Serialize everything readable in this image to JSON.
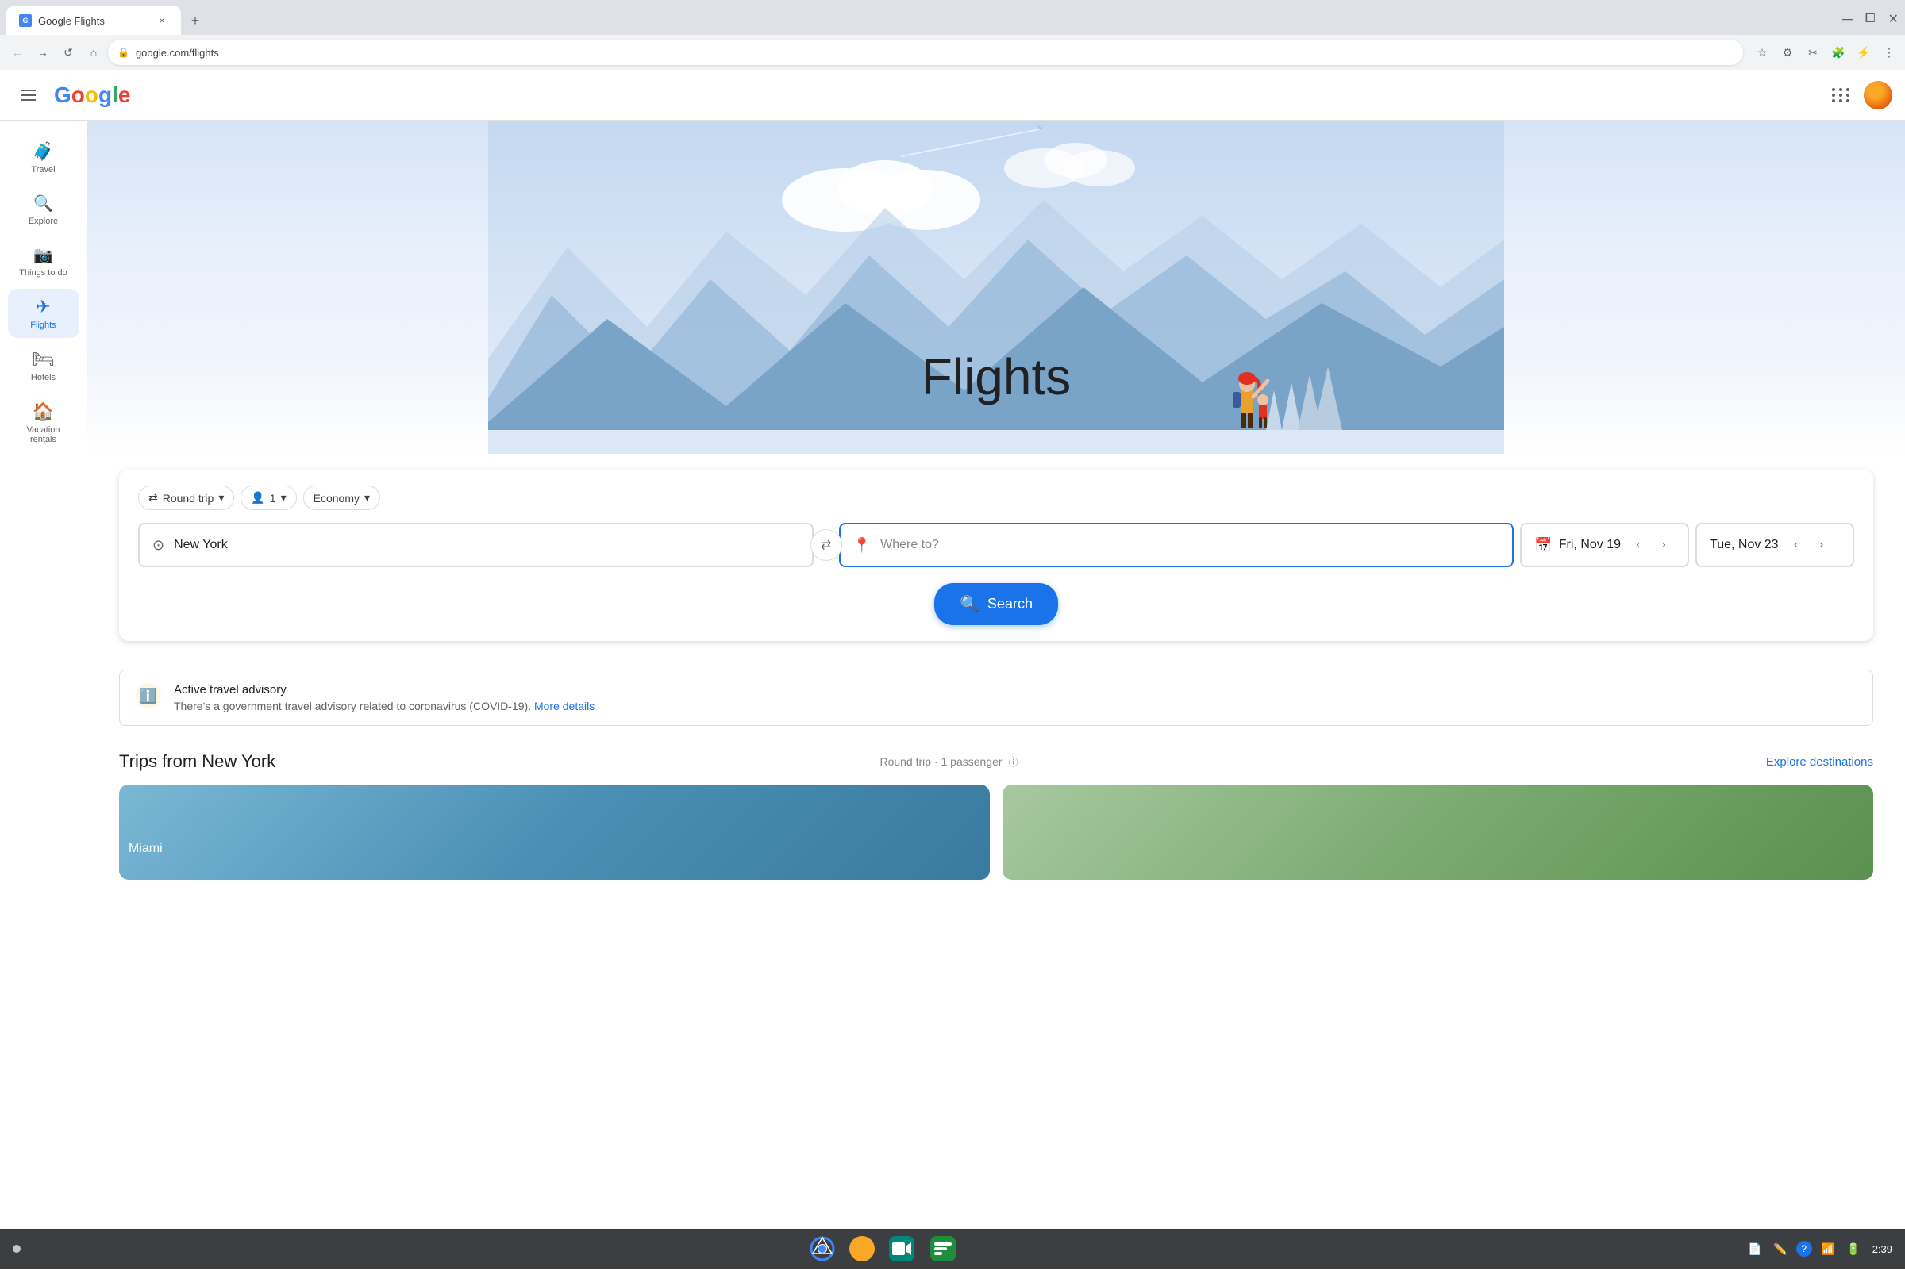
{
  "browser": {
    "tab_title": "Google Flights",
    "url": "google.com/flights",
    "favicon": "G"
  },
  "app_bar": {
    "logo_parts": [
      "G",
      "o",
      "o",
      "g",
      "l",
      "e"
    ],
    "menu_icon": "☰"
  },
  "sidebar": {
    "items": [
      {
        "id": "travel",
        "label": "Travel",
        "icon": "🧳",
        "active": false
      },
      {
        "id": "explore",
        "label": "Explore",
        "icon": "🔍",
        "active": false
      },
      {
        "id": "things-to-do",
        "label": "Things to do",
        "icon": "📷",
        "active": false
      },
      {
        "id": "flights",
        "label": "Flights",
        "icon": "✈️",
        "active": true
      },
      {
        "id": "hotels",
        "label": "Hotels",
        "icon": "🛏️",
        "active": false
      },
      {
        "id": "vacation-rentals",
        "label": "Vacation rentals",
        "icon": "🏠",
        "active": false
      }
    ]
  },
  "hero": {
    "title": "Flights"
  },
  "search": {
    "trip_type": "Round trip",
    "trip_type_dropdown": "▼",
    "passengers": "1",
    "passengers_dropdown": "▼",
    "cabin_class": "Economy",
    "cabin_class_dropdown": "▼",
    "origin": "New York",
    "destination_placeholder": "Where to?",
    "date_departure": "Fri, Nov 19",
    "date_return": "Tue, Nov 23",
    "search_button": "Search"
  },
  "advisory": {
    "title": "Active travel advisory",
    "text": "There's a government travel advisory related to coronavirus (COVID-19).",
    "link_text": "More details",
    "icon": "ℹ️"
  },
  "trips": {
    "title": "Trips from New York",
    "subtitle": "Round trip · 1 passenger",
    "explore_label": "Explore destinations"
  },
  "taskbar": {
    "apps": [
      "🌐",
      "🟡",
      "📹",
      "💬"
    ],
    "time": "2:39"
  }
}
